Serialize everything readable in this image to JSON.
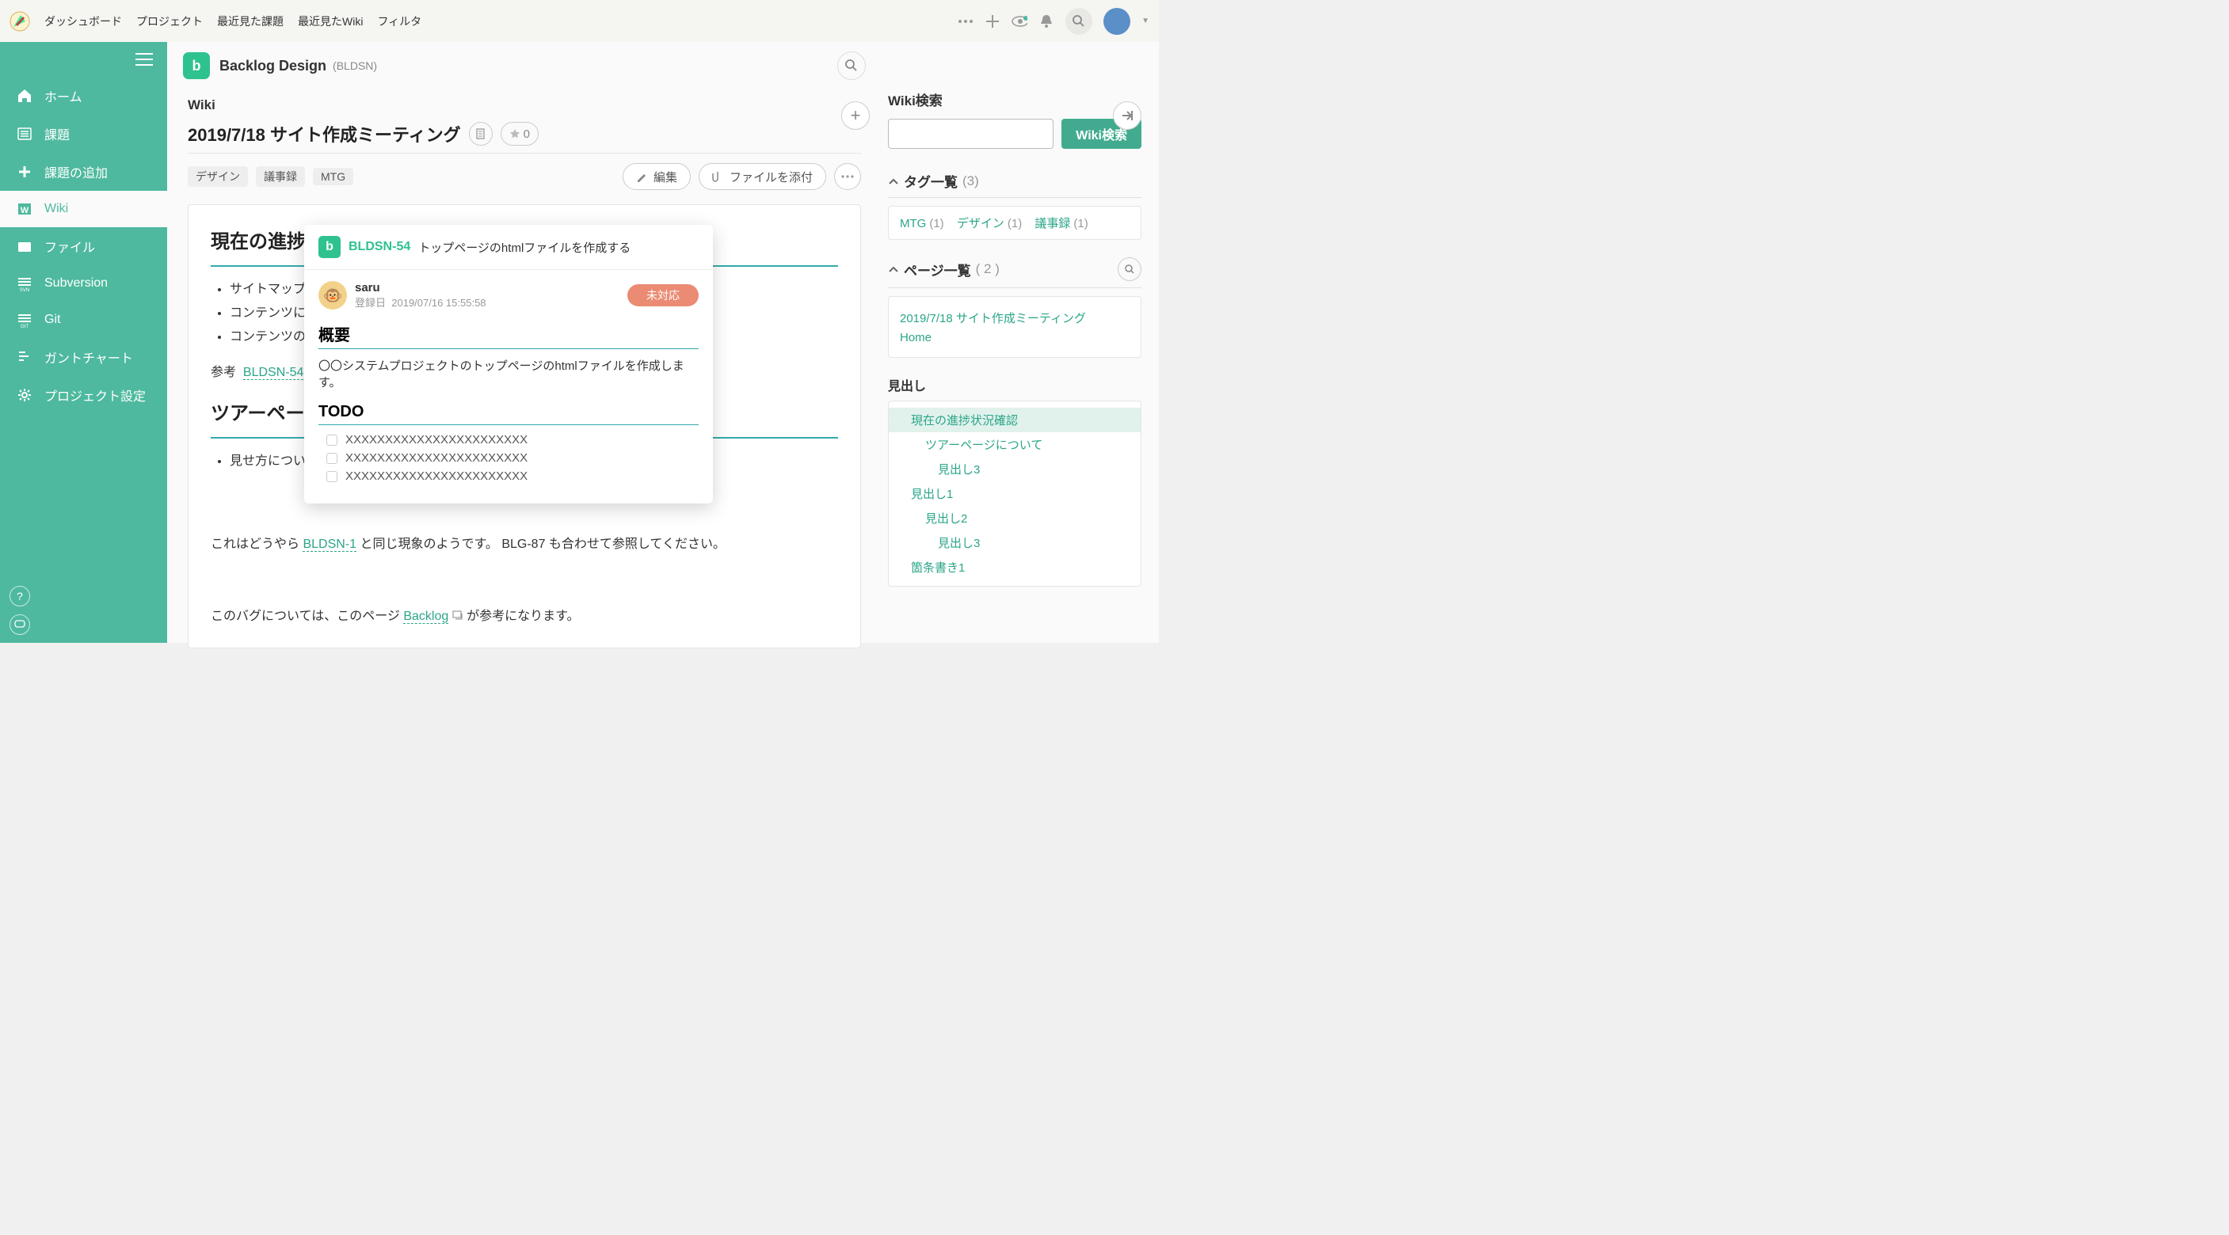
{
  "top_nav": {
    "items": [
      "ダッシュボード",
      "プロジェクト",
      "最近見た課題",
      "最近見たWiki",
      "フィルタ"
    ]
  },
  "project": {
    "name": "Backlog Design",
    "key": "(BLDSN)"
  },
  "sidebar": {
    "items": [
      {
        "label": "ホーム"
      },
      {
        "label": "課題"
      },
      {
        "label": "課題の追加"
      },
      {
        "label": "Wiki"
      },
      {
        "label": "ファイル"
      },
      {
        "label": "Subversion"
      },
      {
        "label": "Git"
      },
      {
        "label": "ガントチャート"
      },
      {
        "label": "プロジェクト設定"
      }
    ]
  },
  "page": {
    "section": "Wiki",
    "title": "2019/7/18 サイト作成ミーティング",
    "star_count": "0",
    "tags": [
      "デザイン",
      "議事録",
      "MTG"
    ],
    "edit_label": "編集",
    "attach_label": "ファイルを添付",
    "h2a": "現在の進捗",
    "bullets": [
      "サイトマップは",
      "コンテンツに不",
      "コンテンツの優"
    ],
    "ref_label": "参考",
    "ref_key": "BLDSN-54",
    "h2b": "ツアーページ",
    "bullets2": [
      "見せ方について"
    ],
    "body_line1_a": "これはどうやら ",
    "body_line1_link": "BLDSN-1",
    "body_line1_b": " と同じ現象のようです。 BLG-87 も合わせて参照してください。",
    "body_line2_a": "このバグについては、このページ ",
    "body_line2_link": "Backlog",
    "body_line2_b": " が参考になります。"
  },
  "rside": {
    "search_title": "Wiki検索",
    "search_btn": "Wiki検索",
    "tags_title": "タグ一覧",
    "tags_count": "(3)",
    "tags": [
      {
        "name": "MTG",
        "count": "(1)"
      },
      {
        "name": "デザイン",
        "count": "(1)"
      },
      {
        "name": "議事録",
        "count": "(1)"
      }
    ],
    "pages_title": "ページ一覧",
    "pages_count": "( 2 )",
    "pages": [
      "2019/7/18 サイト作成ミーティング",
      "Home"
    ],
    "outline_title": "見出し",
    "outline": [
      {
        "label": "現在の進捗状況確認",
        "level": 1,
        "active": true
      },
      {
        "label": "ツアーページについて",
        "level": 2
      },
      {
        "label": "見出し3",
        "level": 3
      },
      {
        "label": "見出し1",
        "level": 1
      },
      {
        "label": "見出し2",
        "level": 2
      },
      {
        "label": "見出し3",
        "level": 3
      },
      {
        "label": "箇条書き1",
        "level": 1
      }
    ]
  },
  "popup": {
    "key": "BLDSN-54",
    "title": "トップページのhtmlファイルを作成する",
    "user": "saru",
    "date_label": "登録日",
    "date": "2019/07/16 15:55:58",
    "status": "未対応",
    "h_overview": "概要",
    "overview_text": "〇〇システムプロジェクトのトップページのhtmlファイルを作成します。",
    "h_todo": "TODO",
    "todos": [
      "XXXXXXXXXXXXXXXXXXXXXXX",
      "XXXXXXXXXXXXXXXXXXXXXXX",
      "XXXXXXXXXXXXXXXXXXXXXXX"
    ]
  }
}
